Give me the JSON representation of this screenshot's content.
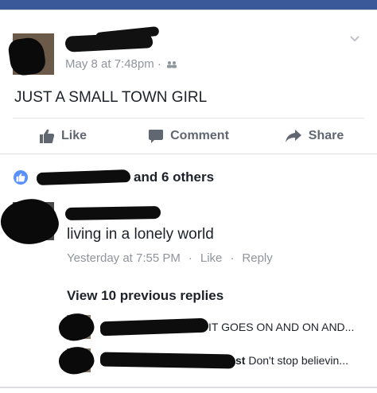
{
  "post": {
    "timestamp": "May 8 at 7:48pm",
    "separator": "·",
    "audience_icon": "friends-icon",
    "text": "JUST A SMALL TOWN GIRL"
  },
  "actions": {
    "like_label": "Like",
    "comment_label": "Comment",
    "share_label": "Share"
  },
  "reactions": {
    "summary_suffix": "and 6 others",
    "icon": "like-badge-icon",
    "badge_color": "#5890ff"
  },
  "comment": {
    "text": "living in a lonely world",
    "time": "Yesterday at 7:55 PM",
    "like_label": "Like",
    "reply_label": "Reply",
    "separator": "·"
  },
  "replies": {
    "view_previous_label": "View 10 previous replies",
    "items": [
      {
        "text": "IT GOES ON AND ON AND..."
      },
      {
        "name_tail": "st",
        "text": "Don't stop believin..."
      }
    ]
  },
  "colors": {
    "brand": "#3b5998",
    "meta_text": "#90949c",
    "action_text": "#606770"
  }
}
